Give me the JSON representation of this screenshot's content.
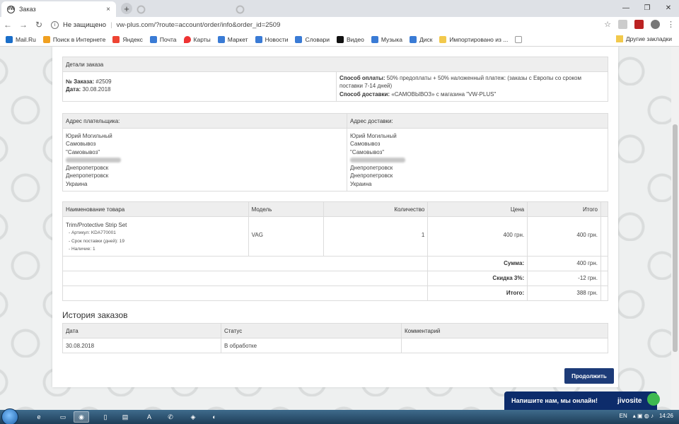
{
  "browser": {
    "active_tab_title": "Заказ",
    "tab_close": "×",
    "new_tab": "+",
    "security_label": "Не защищено",
    "url": "vw-plus.com/?route=account/order/info&order_id=2509",
    "window_controls": [
      "—",
      "❐",
      "✕"
    ]
  },
  "bookmarks": {
    "items": [
      {
        "label": "Mail.Ru",
        "color": "#1a6ec9"
      },
      {
        "label": "Поиск в Интернете",
        "color": "#f0a020"
      },
      {
        "label": "Яндекс",
        "color": "#e43"
      },
      {
        "label": "Почта",
        "color": "#3a7bd5"
      },
      {
        "label": "Карты",
        "color": "#e33"
      },
      {
        "label": "Маркет",
        "color": "#3a7bd5"
      },
      {
        "label": "Новости",
        "color": "#3a7bd5"
      },
      {
        "label": "Словари",
        "color": "#3a7bd5"
      },
      {
        "label": "Видео",
        "color": "#111"
      },
      {
        "label": "Музыка",
        "color": "#3a7bd5"
      },
      {
        "label": "Диск",
        "color": "#3a7bd5"
      },
      {
        "label": "Импортировано из ...",
        "color": "#f2c94c"
      }
    ],
    "other": "Другие закладки"
  },
  "order_details": {
    "header": "Детали заказа",
    "order_no_label": "№ Заказа:",
    "order_no": "#2509",
    "date_label": "Дата:",
    "date": "30.08.2018",
    "payment_label": "Способ оплаты:",
    "payment_line1": "50% предоплаты + 50% наложенный платеж: (заказы с Европы со сроком",
    "payment_line2": "поставки 7-14 дней)",
    "shipping_label": "Способ доставки:",
    "shipping": "«САМОВЫВОЗ» с магазина \"VW-PLUS\""
  },
  "addresses": {
    "payer_header": "Адрес плательщика:",
    "delivery_header": "Адрес доставки:",
    "payer_lines": [
      "Юрий Могильный",
      "Самовывоз",
      "\"Самовывоз\"",
      "",
      "Днепропетровск",
      "Днепропетровск",
      "Украина"
    ],
    "delivery_lines": [
      "Юрий Могильный",
      "Самовывоз",
      "\"Самовывоз\"",
      "",
      "Днепропетровск",
      "Днепропетровск",
      "Украина"
    ]
  },
  "products": {
    "headers": [
      "Наименование товара",
      "Модель",
      "Количество",
      "Цена",
      "Итого"
    ],
    "rows": [
      {
        "name": "Trim/Protective Strip Set",
        "options": [
          "- Артикул: KDA770001",
          "- Срок поставки (дней): 19",
          "- Наличие: 1"
        ],
        "model": "VAG",
        "quantity": "1",
        "price": "400 грн.",
        "total": "400 грн."
      }
    ],
    "totals": [
      {
        "label": "Сумма:",
        "value": "400 грн."
      },
      {
        "label": "Скидка 3%:",
        "value": "-12 грн."
      },
      {
        "label": "Итого:",
        "value": "388 грн."
      }
    ]
  },
  "history": {
    "title": "История заказов",
    "headers": [
      "Дата",
      "Статус",
      "Комментарий"
    ],
    "rows": [
      {
        "date": "30.08.2018",
        "status": "В обработке",
        "comment": ""
      }
    ]
  },
  "continue_label": "Продолжить",
  "chat": {
    "text": "Напишите нам, мы онлайн!",
    "brand": "jivosite"
  },
  "taskbar": {
    "lang": "EN",
    "time": "14:26"
  }
}
